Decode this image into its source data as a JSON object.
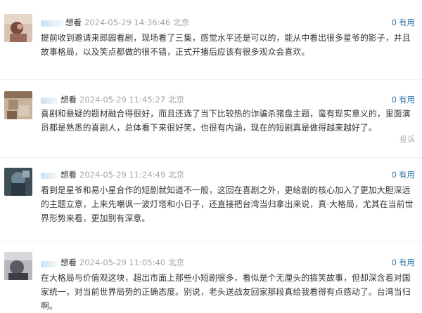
{
  "comments": [
    {
      "rating": "想看",
      "time": "2024-05-29 14:36:46",
      "location": "北京",
      "useful_count": "0",
      "useful_label": "有用",
      "content": "提前收到邀请来郎园看剧，现场看了三集，感觉水平还是可以的，能从中看出很多星爷的影子，并且故事格局，以及笑点都做的很不错，正式开播后应该有很多观众会喜欢。",
      "report": ""
    },
    {
      "rating": "想看",
      "time": "2024-05-29 11:45:27",
      "location": "北京",
      "useful_count": "0",
      "useful_label": "有用",
      "content": "喜剧和悬疑的题材融合得很好，而且还选了当下比较热的诈骗杀猪盘主题，蛮有现实意义的，里面演员都是熟悉的喜剧人，总体看下来很好笑，也很有内涵，现在的短剧真是做得越来越好了。",
      "report": "投诉"
    },
    {
      "rating": "想看",
      "time": "2024-05-29 11:24:49",
      "location": "北京",
      "useful_count": "0",
      "useful_label": "有用",
      "content": "看到是星爷和易小星合作的短剧就知道不一般，这回在喜剧之外，更给剧的核心加入了更加大胆深远的主题立意，上来先嘲讽一波灯塔和小日子，还直接把台湾当归拿出来说，真·大格局，尤其在当前世界形势来看，更加别有深意。",
      "report": ""
    },
    {
      "rating": "想看",
      "time": "2024-05-29 11:05:40",
      "location": "北京",
      "useful_count": "0",
      "useful_label": "有用",
      "content": "在大格局与价值观这块，超出市面上那些小短剧很多，看似是个无厘头的搞笑故事，但却深含着对国家统一，对当前世界局势的正确态度。别说，老头送战友回家那段真给我看得有点感动了。台湾当归啊。",
      "report": ""
    }
  ]
}
